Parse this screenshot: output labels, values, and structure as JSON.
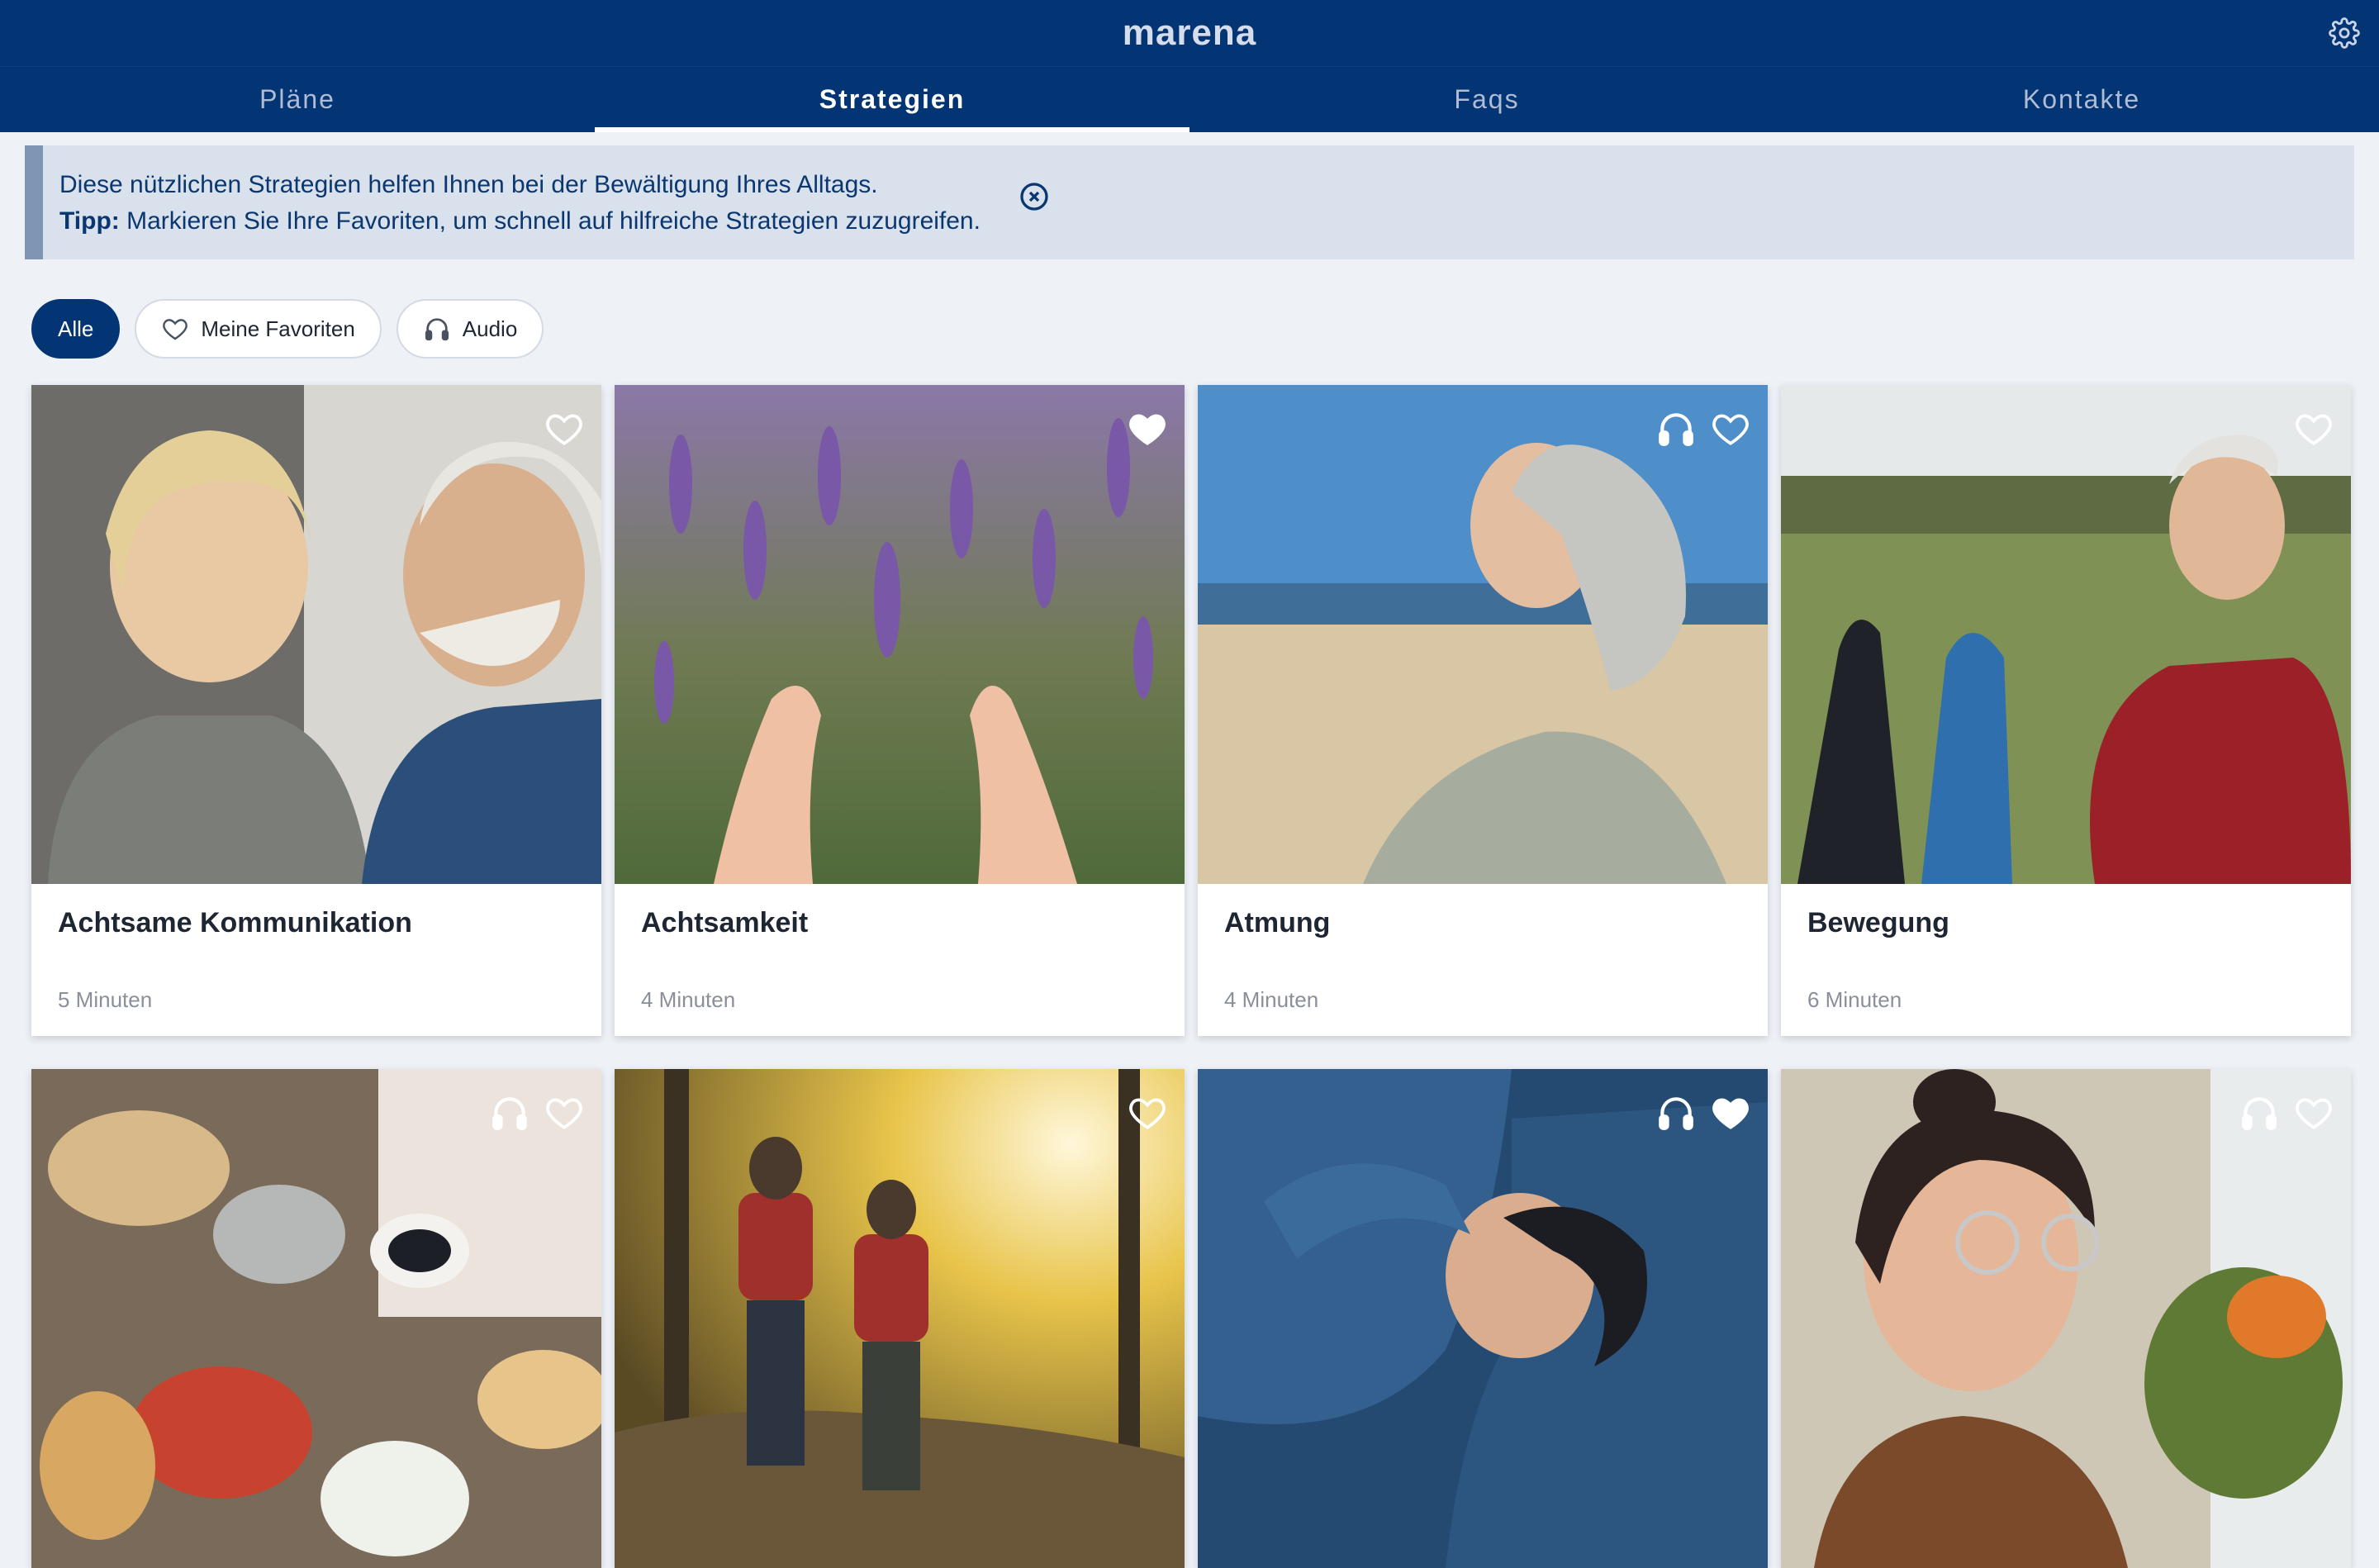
{
  "header": {
    "brand": "marena",
    "settings_icon": "gear-icon"
  },
  "tabs": [
    {
      "label": "Pläne",
      "active": false
    },
    {
      "label": "Strategien",
      "active": true
    },
    {
      "label": "Faqs",
      "active": false
    },
    {
      "label": "Kontakte",
      "active": false
    }
  ],
  "banner": {
    "line1": "Diese nützlichen Strategien helfen Ihnen bei der Bewältigung Ihres Alltags.",
    "tip_label": "Tipp:",
    "tip_text": "Markieren Sie Ihre Favoriten, um schnell auf hilfreiche Strategien zuzugreifen."
  },
  "filters": [
    {
      "label": "Alle",
      "icon": null,
      "active": true
    },
    {
      "label": "Meine Favoriten",
      "icon": "heart-outline-icon",
      "active": false
    },
    {
      "label": "Audio",
      "icon": "headphones-icon",
      "active": false
    }
  ],
  "cards": [
    {
      "title": "Achtsame Kommunikation",
      "duration": "5 Minuten",
      "audio": false,
      "favorite": false,
      "image": "couple-talking"
    },
    {
      "title": "Achtsamkeit",
      "duration": "4 Minuten",
      "audio": false,
      "favorite": true,
      "image": "lavender-hands"
    },
    {
      "title": "Atmung",
      "duration": "4 Minuten",
      "audio": true,
      "favorite": false,
      "image": "woman-beach"
    },
    {
      "title": "Bewegung",
      "duration": "6 Minuten",
      "audio": false,
      "favorite": false,
      "image": "outdoor-stretching"
    },
    {
      "title": "",
      "duration": "",
      "audio": true,
      "favorite": false,
      "image": "food-table"
    },
    {
      "title": "",
      "duration": "",
      "audio": false,
      "favorite": false,
      "image": "forest-hikers"
    },
    {
      "title": "",
      "duration": "",
      "audio": true,
      "favorite": true,
      "image": "woman-sleeping"
    },
    {
      "title": "",
      "duration": "",
      "audio": true,
      "favorite": false,
      "image": "woman-smiling-glasses"
    }
  ],
  "colors": {
    "primary": "#033473",
    "background": "#eef1f6",
    "banner": "#d9e1ec",
    "banner_accent": "#7f95b4"
  }
}
